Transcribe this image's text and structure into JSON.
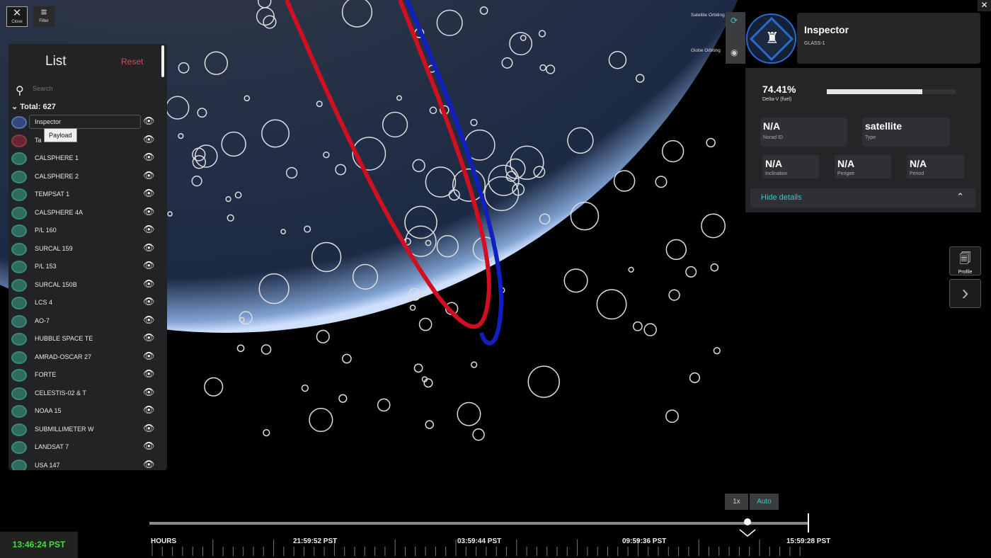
{
  "toolbar": {
    "close_label": "Close",
    "filter_label": "Filter"
  },
  "list": {
    "title": "List",
    "reset_label": "Reset",
    "search_placeholder": "Search",
    "total_label": "Total: 627",
    "tooltip": "Payload",
    "items": [
      "Inspector",
      "Ta",
      "CALSPHERE 1",
      "CALSPHERE 2",
      "TEMPSAT 1",
      "CALSPHERE 4A",
      "P/L 160",
      "SURCAL 159",
      "P/L 153",
      "SURCAL 150B",
      "LCS 4",
      "AO-7",
      "HUBBLE SPACE TE",
      "AMRAD-OSCAR 27",
      "FORTE",
      "CELESTIS-02 & T",
      "NOAA 15",
      "SUBMILLIMETER W",
      "LANDSAT 7",
      "USA 147"
    ]
  },
  "view_modes": {
    "satellite": "Satellite Orbiting",
    "globe": "Globe Orbiting"
  },
  "object": {
    "name": "Inspector",
    "subtitle": "GLASS-1",
    "fuel_value": "74.41%",
    "fuel_percent": 74.41,
    "fuel_label": "Delta-V (fuel)",
    "norad_value": "N/A",
    "norad_label": "Norad ID",
    "type_value": "satellite",
    "type_label": "Type",
    "inclination_value": "N/A",
    "inclination_label": "Inclination",
    "perigee_value": "N/A",
    "perigee_label": "Perigee",
    "period_value": "N/A",
    "period_label": "Period",
    "hide_label": "Hide details"
  },
  "side": {
    "profile_label": "Profile"
  },
  "time": {
    "clock": "13:46:24 PST",
    "speed": "1x",
    "auto": "Auto",
    "scale_label": "HOURS",
    "ticks": [
      "21:59:52 PST",
      "03:59:44 PST",
      "09:59:36 PST",
      "15:59:28 PST"
    ],
    "progress_percent": 90
  },
  "colors": {
    "accent": "#3fc6c9",
    "reset": "#d44a5f",
    "clock": "#3ee03e",
    "orbit_red": "#d01020",
    "orbit_blue": "#1020c0"
  }
}
